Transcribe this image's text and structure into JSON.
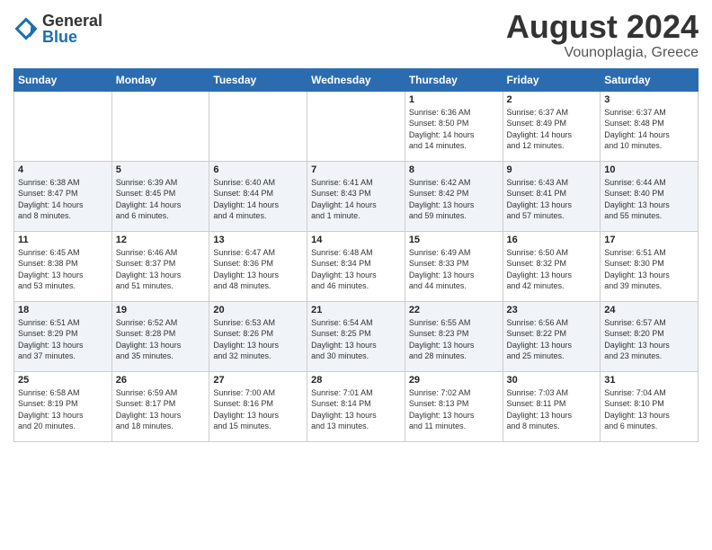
{
  "logo": {
    "general": "General",
    "blue": "Blue"
  },
  "title": "August 2024",
  "location": "Vounoplagia, Greece",
  "days_of_week": [
    "Sunday",
    "Monday",
    "Tuesday",
    "Wednesday",
    "Thursday",
    "Friday",
    "Saturday"
  ],
  "weeks": [
    [
      {
        "day": "",
        "info": ""
      },
      {
        "day": "",
        "info": ""
      },
      {
        "day": "",
        "info": ""
      },
      {
        "day": "",
        "info": ""
      },
      {
        "day": "1",
        "info": "Sunrise: 6:36 AM\nSunset: 8:50 PM\nDaylight: 14 hours\nand 14 minutes."
      },
      {
        "day": "2",
        "info": "Sunrise: 6:37 AM\nSunset: 8:49 PM\nDaylight: 14 hours\nand 12 minutes."
      },
      {
        "day": "3",
        "info": "Sunrise: 6:37 AM\nSunset: 8:48 PM\nDaylight: 14 hours\nand 10 minutes."
      }
    ],
    [
      {
        "day": "4",
        "info": "Sunrise: 6:38 AM\nSunset: 8:47 PM\nDaylight: 14 hours\nand 8 minutes."
      },
      {
        "day": "5",
        "info": "Sunrise: 6:39 AM\nSunset: 8:45 PM\nDaylight: 14 hours\nand 6 minutes."
      },
      {
        "day": "6",
        "info": "Sunrise: 6:40 AM\nSunset: 8:44 PM\nDaylight: 14 hours\nand 4 minutes."
      },
      {
        "day": "7",
        "info": "Sunrise: 6:41 AM\nSunset: 8:43 PM\nDaylight: 14 hours\nand 1 minute."
      },
      {
        "day": "8",
        "info": "Sunrise: 6:42 AM\nSunset: 8:42 PM\nDaylight: 13 hours\nand 59 minutes."
      },
      {
        "day": "9",
        "info": "Sunrise: 6:43 AM\nSunset: 8:41 PM\nDaylight: 13 hours\nand 57 minutes."
      },
      {
        "day": "10",
        "info": "Sunrise: 6:44 AM\nSunset: 8:40 PM\nDaylight: 13 hours\nand 55 minutes."
      }
    ],
    [
      {
        "day": "11",
        "info": "Sunrise: 6:45 AM\nSunset: 8:38 PM\nDaylight: 13 hours\nand 53 minutes."
      },
      {
        "day": "12",
        "info": "Sunrise: 6:46 AM\nSunset: 8:37 PM\nDaylight: 13 hours\nand 51 minutes."
      },
      {
        "day": "13",
        "info": "Sunrise: 6:47 AM\nSunset: 8:36 PM\nDaylight: 13 hours\nand 48 minutes."
      },
      {
        "day": "14",
        "info": "Sunrise: 6:48 AM\nSunset: 8:34 PM\nDaylight: 13 hours\nand 46 minutes."
      },
      {
        "day": "15",
        "info": "Sunrise: 6:49 AM\nSunset: 8:33 PM\nDaylight: 13 hours\nand 44 minutes."
      },
      {
        "day": "16",
        "info": "Sunrise: 6:50 AM\nSunset: 8:32 PM\nDaylight: 13 hours\nand 42 minutes."
      },
      {
        "day": "17",
        "info": "Sunrise: 6:51 AM\nSunset: 8:30 PM\nDaylight: 13 hours\nand 39 minutes."
      }
    ],
    [
      {
        "day": "18",
        "info": "Sunrise: 6:51 AM\nSunset: 8:29 PM\nDaylight: 13 hours\nand 37 minutes."
      },
      {
        "day": "19",
        "info": "Sunrise: 6:52 AM\nSunset: 8:28 PM\nDaylight: 13 hours\nand 35 minutes."
      },
      {
        "day": "20",
        "info": "Sunrise: 6:53 AM\nSunset: 8:26 PM\nDaylight: 13 hours\nand 32 minutes."
      },
      {
        "day": "21",
        "info": "Sunrise: 6:54 AM\nSunset: 8:25 PM\nDaylight: 13 hours\nand 30 minutes."
      },
      {
        "day": "22",
        "info": "Sunrise: 6:55 AM\nSunset: 8:23 PM\nDaylight: 13 hours\nand 28 minutes."
      },
      {
        "day": "23",
        "info": "Sunrise: 6:56 AM\nSunset: 8:22 PM\nDaylight: 13 hours\nand 25 minutes."
      },
      {
        "day": "24",
        "info": "Sunrise: 6:57 AM\nSunset: 8:20 PM\nDaylight: 13 hours\nand 23 minutes."
      }
    ],
    [
      {
        "day": "25",
        "info": "Sunrise: 6:58 AM\nSunset: 8:19 PM\nDaylight: 13 hours\nand 20 minutes."
      },
      {
        "day": "26",
        "info": "Sunrise: 6:59 AM\nSunset: 8:17 PM\nDaylight: 13 hours\nand 18 minutes."
      },
      {
        "day": "27",
        "info": "Sunrise: 7:00 AM\nSunset: 8:16 PM\nDaylight: 13 hours\nand 15 minutes."
      },
      {
        "day": "28",
        "info": "Sunrise: 7:01 AM\nSunset: 8:14 PM\nDaylight: 13 hours\nand 13 minutes."
      },
      {
        "day": "29",
        "info": "Sunrise: 7:02 AM\nSunset: 8:13 PM\nDaylight: 13 hours\nand 11 minutes."
      },
      {
        "day": "30",
        "info": "Sunrise: 7:03 AM\nSunset: 8:11 PM\nDaylight: 13 hours\nand 8 minutes."
      },
      {
        "day": "31",
        "info": "Sunrise: 7:04 AM\nSunset: 8:10 PM\nDaylight: 13 hours\nand 6 minutes."
      }
    ]
  ]
}
